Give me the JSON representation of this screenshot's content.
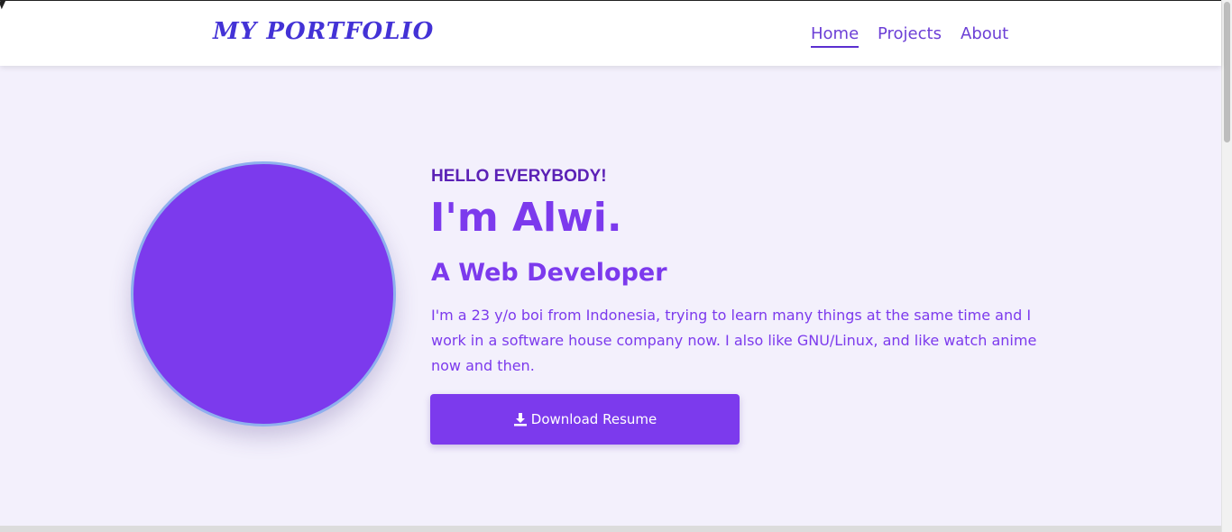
{
  "nav": {
    "brand": "MY PORTFOLIO",
    "links": [
      {
        "label": "Home",
        "active": true
      },
      {
        "label": "Projects",
        "active": false
      },
      {
        "label": "About",
        "active": false
      }
    ]
  },
  "hero": {
    "greeting": "HELLO EVERYBODY!",
    "name": "I'm Alwi.",
    "role": "A Web Developer",
    "bio": "I'm a 23 y/o boi from Indonesia, trying to learn many things at the same time and I work in a software house company now. I also like GNU/Linux, and like watch anime now and then.",
    "download_label": "Download Resume",
    "download_icon": "download-icon"
  },
  "colors": {
    "accent": "#7c3aed",
    "brand": "#4332d6",
    "background": "#f3f0fc",
    "avatar_ring": "#8fb0ee"
  }
}
